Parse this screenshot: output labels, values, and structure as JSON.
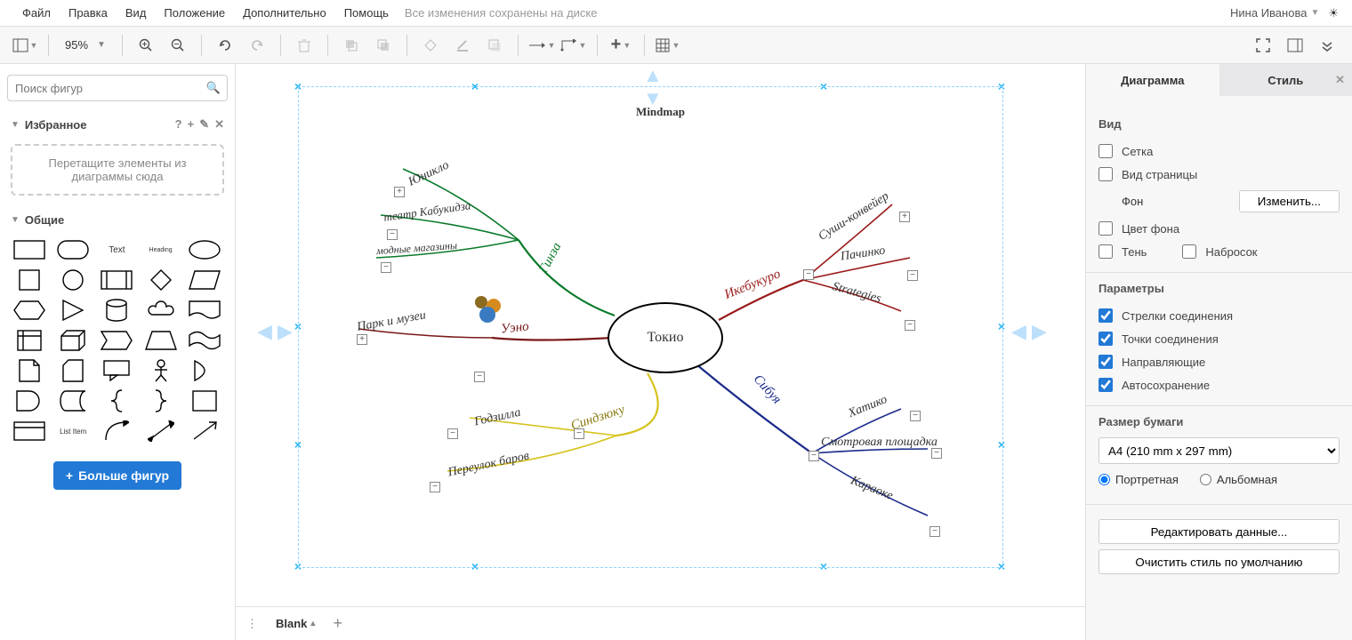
{
  "menubar": {
    "file": "Файл",
    "edit": "Правка",
    "view": "Вид",
    "arrange": "Положение",
    "extras": "Дополнительно",
    "help": "Помощь",
    "save_status": "Все изменения сохранены на диске",
    "user": "Нина Иванова"
  },
  "toolbar": {
    "zoom": "95%"
  },
  "sidebar": {
    "search_placeholder": "Поиск фигур",
    "favorites": "Избранное",
    "dropzone": "Перетащите элементы из диаграммы сюда",
    "general": "Общие",
    "shape_text": "Text",
    "shape_heading": "Heading",
    "shape_listitem": "List Item",
    "more_shapes": "Больше фигур"
  },
  "canvas": {
    "mindmap_title": "Mindmap",
    "center": "Токио",
    "branches": {
      "ginza": "Гинза",
      "uniqlo": "Юникло",
      "kabukiza": "театр Кабукидза",
      "shops": "модные магазины",
      "ueno": "Уэно",
      "park": "Парк и музеи",
      "shinjuku": "Синдзюку",
      "godzilla": "Годзилла",
      "bars": "Переулок баров",
      "ikebukuro": "Икебукуро",
      "sushi": "Суши-конвейер",
      "pachinko": "Пачинко",
      "strategies": "Strategies",
      "shibuya": "Сибуя",
      "hachiko": "Хатико",
      "observatory": "Смотровая площадка",
      "karaoke": "Караоке"
    }
  },
  "footer": {
    "tab": "Blank"
  },
  "right": {
    "tab_diagram": "Диаграмма",
    "tab_style": "Стиль",
    "view_title": "Вид",
    "grid": "Сетка",
    "page_view": "Вид страницы",
    "background": "Фон",
    "change": "Изменить...",
    "background_color": "Цвет фона",
    "shadow": "Тень",
    "sketch": "Набросок",
    "params": "Параметры",
    "conn_arrows": "Стрелки соединения",
    "conn_points": "Точки соединения",
    "guides": "Направляющие",
    "autosave": "Автосохранение",
    "paper_size_title": "Размер бумаги",
    "paper_size_value": "A4 (210 mm x 297 mm)",
    "portrait": "Портретная",
    "landscape": "Альбомная",
    "edit_data": "Редактировать данные...",
    "clear_style": "Очистить стиль по умолчанию"
  }
}
